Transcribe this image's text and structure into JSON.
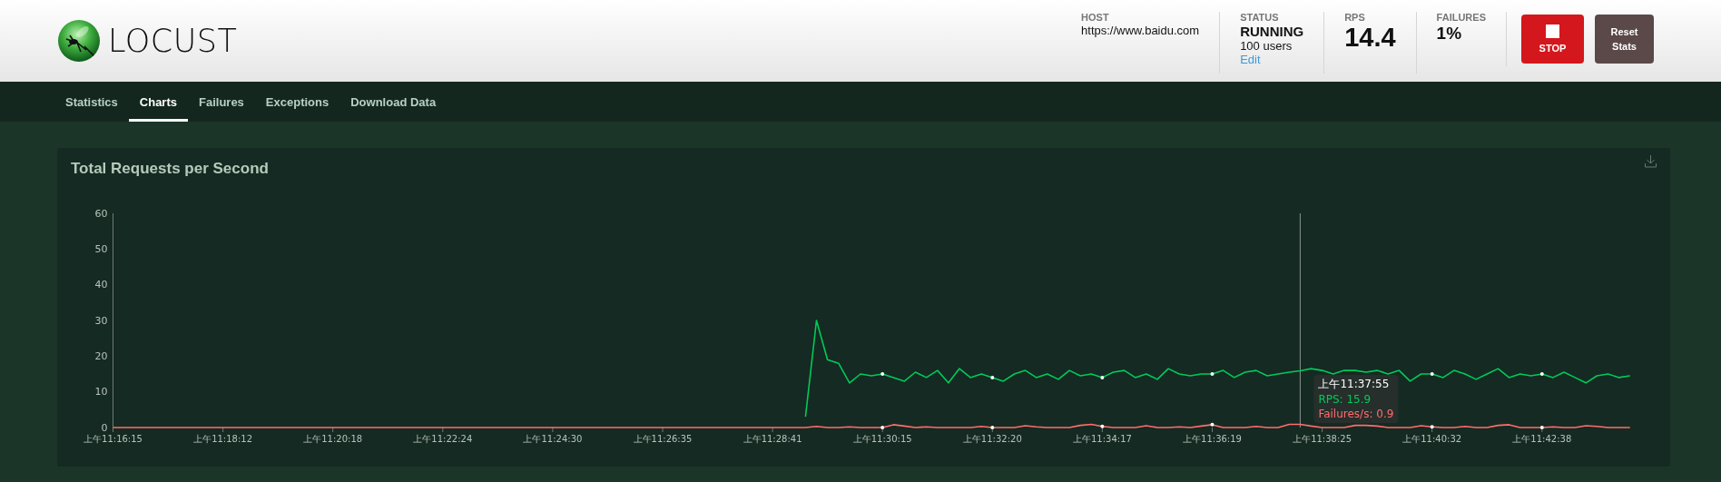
{
  "header": {
    "logo": "LOCUST",
    "stats": [
      {
        "kind": "text",
        "label": "HOST",
        "value": "https://www.baidu.com"
      },
      {
        "kind": "status",
        "label": "STATUS",
        "value": "RUNNING",
        "users": "100 users",
        "link": "Edit"
      },
      {
        "kind": "big",
        "label": "RPS",
        "value": "14.4"
      },
      {
        "kind": "medium",
        "label": "FAILURES",
        "value": "1%"
      }
    ],
    "buttons": [
      {
        "kind": "stop",
        "label": "STOP"
      },
      {
        "kind": "reset",
        "label": "Reset Stats"
      }
    ]
  },
  "tabs": [
    {
      "label": "Statistics",
      "selected": false
    },
    {
      "label": "Charts",
      "selected": true
    },
    {
      "label": "Failures",
      "selected": false
    },
    {
      "label": "Exceptions",
      "selected": false
    },
    {
      "label": "Download Data",
      "selected": false
    }
  ],
  "chart_card": {
    "title": "Total Requests per Second",
    "chart_data": {
      "type": "line",
      "ylim": [
        0,
        60
      ],
      "yticks": [
        0,
        10,
        20,
        30,
        40,
        50,
        60
      ],
      "categories": [
        "上午11:16:15",
        null,
        null,
        null,
        null,
        null,
        null,
        null,
        null,
        null,
        "上午11:18:12",
        null,
        null,
        null,
        null,
        null,
        null,
        null,
        null,
        null,
        "上午11:20:18",
        null,
        null,
        null,
        null,
        null,
        null,
        null,
        null,
        null,
        "上午11:22:24",
        null,
        null,
        null,
        null,
        null,
        null,
        null,
        null,
        null,
        "上午11:24:30",
        null,
        null,
        null,
        null,
        null,
        null,
        null,
        null,
        null,
        "上午11:26:35",
        null,
        null,
        null,
        null,
        null,
        null,
        null,
        null,
        null,
        "上午11:28:41",
        null,
        null,
        null,
        null,
        null,
        null,
        null,
        null,
        null,
        "上午11:30:15",
        null,
        null,
        null,
        null,
        null,
        null,
        null,
        null,
        null,
        "上午11:32:20",
        null,
        null,
        null,
        null,
        null,
        null,
        null,
        null,
        null,
        "上午11:34:17",
        null,
        null,
        null,
        null,
        null,
        null,
        null,
        null,
        null,
        "上午11:36:19",
        null,
        null,
        null,
        null,
        null,
        null,
        null,
        null,
        null,
        "上午11:38:25",
        null,
        null,
        null,
        null,
        null,
        null,
        null,
        null,
        null,
        "上午11:40:32",
        null,
        null,
        null,
        null,
        null,
        null,
        null,
        null,
        null,
        "上午11:42:38",
        null,
        null,
        null,
        null,
        null,
        null,
        null,
        null
      ],
      "series": [
        {
          "color": "#00ca5a",
          "values": [
            null,
            null,
            null,
            null,
            null,
            null,
            null,
            null,
            null,
            null,
            null,
            null,
            null,
            null,
            null,
            null,
            null,
            null,
            null,
            null,
            null,
            null,
            null,
            null,
            null,
            null,
            null,
            null,
            null,
            null,
            null,
            null,
            null,
            null,
            null,
            null,
            null,
            null,
            null,
            null,
            null,
            null,
            null,
            null,
            null,
            null,
            null,
            null,
            null,
            null,
            null,
            null,
            null,
            null,
            null,
            null,
            null,
            null,
            null,
            null,
            null,
            null,
            null,
            3,
            30,
            19,
            18,
            12.5,
            15,
            14.5,
            15,
            14,
            13,
            15.5,
            14,
            16,
            12.5,
            16.5,
            14,
            15,
            14,
            13,
            15,
            16,
            14,
            15,
            13.5,
            16,
            14.5,
            15,
            14,
            15.5,
            16,
            14,
            15,
            13.5,
            16.5,
            15,
            14.5,
            15,
            15,
            16,
            14,
            15.5,
            16,
            14.5,
            15,
            15.5,
            15.9,
            16.5,
            16,
            15,
            16,
            16,
            15.5,
            16,
            15,
            16,
            13,
            15,
            15,
            14,
            16,
            15,
            13.5,
            15,
            16.5,
            14,
            15,
            14.5,
            15,
            14,
            15.5,
            14,
            12.5,
            14.5,
            15,
            14,
            14.5
          ]
        },
        {
          "color": "#ff6d6d",
          "values": [
            0,
            0,
            0,
            0,
            0,
            0,
            0,
            0,
            0,
            0,
            0,
            0,
            0,
            0,
            0,
            0,
            0,
            0,
            0,
            0,
            0,
            0,
            0,
            0,
            0,
            0,
            0,
            0,
            0,
            0,
            0,
            0,
            0,
            0,
            0,
            0,
            0,
            0,
            0,
            0,
            0,
            0,
            0,
            0,
            0,
            0,
            0,
            0,
            0,
            0,
            0,
            0,
            0,
            0,
            0,
            0,
            0,
            0,
            0,
            0,
            0,
            0,
            0,
            0,
            0.3,
            0,
            0,
            0.2,
            0,
            0,
            0,
            0.8,
            0.4,
            0,
            0.2,
            0,
            0,
            0,
            0,
            0.3,
            0,
            0,
            0,
            0.5,
            0.2,
            0,
            0,
            0,
            0.6,
            0.9,
            0.3,
            0,
            0,
            0,
            0.5,
            0,
            0,
            0.2,
            0,
            0.4,
            0.8,
            0,
            0,
            0,
            0.3,
            0,
            0,
            0.9,
            0.9,
            0.4,
            0,
            0,
            0,
            0.6,
            0.6,
            0.4,
            0,
            0,
            0,
            0.5,
            0.2,
            0,
            0,
            0.3,
            0,
            0,
            0.6,
            0.8,
            0,
            0,
            0,
            0.2,
            0,
            0,
            0.5,
            0.3,
            0,
            0,
            0
          ]
        }
      ],
      "annotations": [
        "上午11:37:55"
      ]
    },
    "tooltip": {
      "rows": [
        {
          "text": "RPS: 15.9",
          "color": "#00ca5a"
        },
        {
          "text": "Failures/s: 0.9",
          "color": "#ff6d6d"
        }
      ]
    }
  }
}
